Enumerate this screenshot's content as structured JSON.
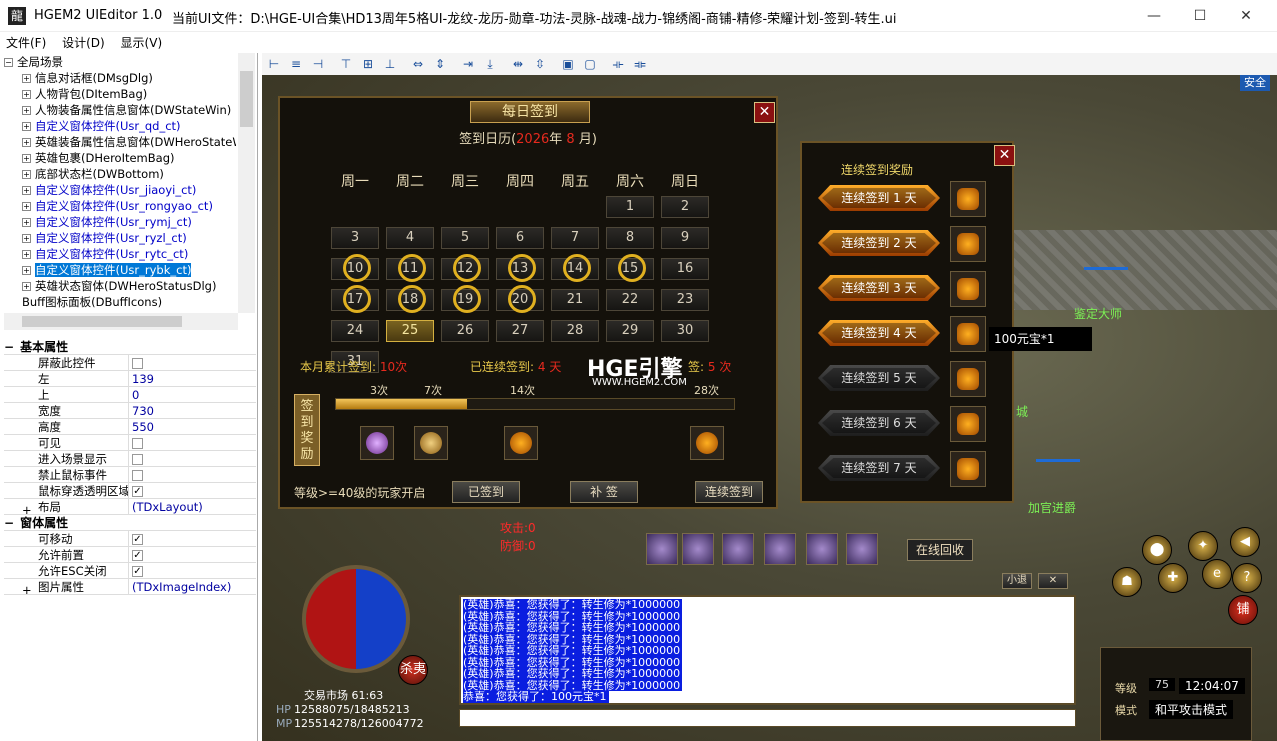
{
  "titlebar": {
    "app": "HGEM2 UIEditor 1.0",
    "file": "当前UI文件：D:\\HGE-UI合集\\HD13周年5格UI-龙纹-龙历-勋章-功法-灵脉-战魂-战力-锦绣阁-商铺-精修-荣耀计划-签到-转生.ui",
    "minimize": "—",
    "maximize": "☐",
    "close": "✕"
  },
  "menu": [
    "文件(F)",
    "设计(D)",
    "显示(V)"
  ],
  "tree": [
    {
      "label": "全局场景",
      "exp": "−",
      "indent": 0,
      "style": ""
    },
    {
      "label": "信息对话框(DMsgDlg)",
      "exp": "+",
      "indent": 1,
      "style": ""
    },
    {
      "label": "人物背包(DItemBag)",
      "exp": "+",
      "indent": 1,
      "style": ""
    },
    {
      "label": "人物装备属性信息窗体(DWStateWin)",
      "exp": "+",
      "indent": 1,
      "style": ""
    },
    {
      "label": "自定义窗体控件(Usr_qd_ct)",
      "exp": "+",
      "indent": 1,
      "style": "blue"
    },
    {
      "label": "英雄装备属性信息窗体(DWHeroStateW",
      "exp": "+",
      "indent": 1,
      "style": ""
    },
    {
      "label": "英雄包裹(DHeroItemBag)",
      "exp": "+",
      "indent": 1,
      "style": ""
    },
    {
      "label": "底部状态栏(DWBottom)",
      "exp": "+",
      "indent": 1,
      "style": ""
    },
    {
      "label": "自定义窗体控件(Usr_jiaoyi_ct)",
      "exp": "+",
      "indent": 1,
      "style": "blue"
    },
    {
      "label": "自定义窗体控件(Usr_rongyao_ct)",
      "exp": "+",
      "indent": 1,
      "style": "blue"
    },
    {
      "label": "自定义窗体控件(Usr_rymj_ct)",
      "exp": "+",
      "indent": 1,
      "style": "blue"
    },
    {
      "label": "自定义窗体控件(Usr_ryzl_ct)",
      "exp": "+",
      "indent": 1,
      "style": "blue"
    },
    {
      "label": "自定义窗体控件(Usr_rytc_ct)",
      "exp": "+",
      "indent": 1,
      "style": "blue"
    },
    {
      "label": "自定义窗体控件(Usr_rybk_ct)",
      "exp": "+",
      "indent": 1,
      "style": "sel"
    },
    {
      "label": "英雄状态窗体(DWHeroStatusDlg)",
      "exp": "+",
      "indent": 1,
      "style": ""
    },
    {
      "label": "Buff图标面板(DBuffIcons)",
      "exp": "",
      "indent": 1,
      "style": ""
    }
  ],
  "props": {
    "basic_title": "基本属性",
    "basic": [
      {
        "k": "屏蔽此控件",
        "v": "",
        "check": "off"
      },
      {
        "k": "左",
        "v": "139",
        "check": ""
      },
      {
        "k": "上",
        "v": "0",
        "check": ""
      },
      {
        "k": "宽度",
        "v": "730",
        "check": ""
      },
      {
        "k": "高度",
        "v": "550",
        "check": ""
      },
      {
        "k": "可见",
        "v": "",
        "check": "off"
      },
      {
        "k": "进入场景显示",
        "v": "",
        "check": "off"
      },
      {
        "k": "禁止鼠标事件",
        "v": "",
        "check": "off"
      },
      {
        "k": "鼠标穿透透明区域",
        "v": "",
        "check": "on"
      },
      {
        "k": "布局",
        "v": "(TDxLayout)",
        "check": "",
        "exp": "+"
      }
    ],
    "win_title": "窗体属性",
    "win": [
      {
        "k": "可移动",
        "v": "",
        "check": "on"
      },
      {
        "k": "允许前置",
        "v": "",
        "check": "on"
      },
      {
        "k": "允许ESC关闭",
        "v": "",
        "check": "on"
      },
      {
        "k": "图片属性",
        "v": "(TDxImageIndex)",
        "check": "",
        "exp": "+"
      }
    ]
  },
  "signin": {
    "header": "每日签到",
    "cal_prefix": "签到日历(",
    "year": "2026",
    "year_suffix": "年",
    "month": "8",
    "month_suffix": "月)",
    "weekdays": [
      "周一",
      "周二",
      "周三",
      "周四",
      "周五",
      "周六",
      "周日"
    ],
    "days_signed_rings": [
      10,
      11,
      12,
      13,
      14,
      15,
      17,
      18,
      19,
      20
    ],
    "today": 25,
    "total_label": "本月累计签到:",
    "total_value": "10",
    "total_unit": "次",
    "consec_label": "已连续签到:",
    "consec_value": "4",
    "consec_unit": "天",
    "remaining_label": "签:",
    "remaining_value": "5",
    "remaining_unit": "次",
    "progress_labels": [
      "3次",
      "7次",
      "14次",
      "28次"
    ],
    "progress_fraction": 0.33,
    "side_button": "签到奖励",
    "level_note": "等级>=40级的玩家开启",
    "btn_signed": "已签到",
    "btn_makeup": "补 签",
    "btn_consec": "连续签到"
  },
  "reward": {
    "title": "连续签到奖励",
    "items": [
      {
        "label": "连续签到 1 天",
        "state": "on"
      },
      {
        "label": "连续签到 2 天",
        "state": "on"
      },
      {
        "label": "连续签到 3 天",
        "state": "on"
      },
      {
        "label": "连续签到 4 天",
        "state": "on"
      },
      {
        "label": "连续签到 5 天",
        "state": "off"
      },
      {
        "label": "连续签到 6 天",
        "state": "off"
      },
      {
        "label": "连续签到 7 天",
        "state": "off"
      }
    ],
    "tooltip": "100元宝*1"
  },
  "watermark": {
    "main": "HGE引擎",
    "sub": "WWW.HGEM2.COM"
  },
  "npcs": {
    "npc1": "鉴定大师",
    "npc2": "加官进爵",
    "npc3": "城"
  },
  "stats": {
    "red1": "攻击:0",
    "red2": "防御:0",
    "map": "交易市场 61:63",
    "hp": "12588075/18485213",
    "mp": "125514278/126004772",
    "hp_lbl": "HP",
    "mp_lbl": "MP"
  },
  "chat": {
    "lines": [
      "(英雄)恭喜：您获得了：转生修为*1000000",
      "(英雄)恭喜：您获得了：转生修为*1000000",
      "(英雄)恭喜：您获得了：转生修为*1000000",
      "(英雄)恭喜：您获得了：转生修为*1000000",
      "(英雄)恭喜：您获得了：转生修为*1000000",
      "(英雄)恭喜：您获得了：转生修为*1000000",
      "(英雄)恭喜：您获得了：转生修为*1000000",
      "(英雄)恭喜：您获得了：转生修为*1000000"
    ],
    "last": "恭喜：您获得了：100元宝*1",
    "small_btn": "小退",
    "close_btn": "✕"
  },
  "right": {
    "recycle": "在线回收",
    "level_lbl": "等级",
    "level_val": "75",
    "time": "12:04:07",
    "mode_lbl": "模式",
    "mode_val": "和平攻击模式",
    "safe": "安全",
    "shop": "铺",
    "sell": "杀夷"
  }
}
